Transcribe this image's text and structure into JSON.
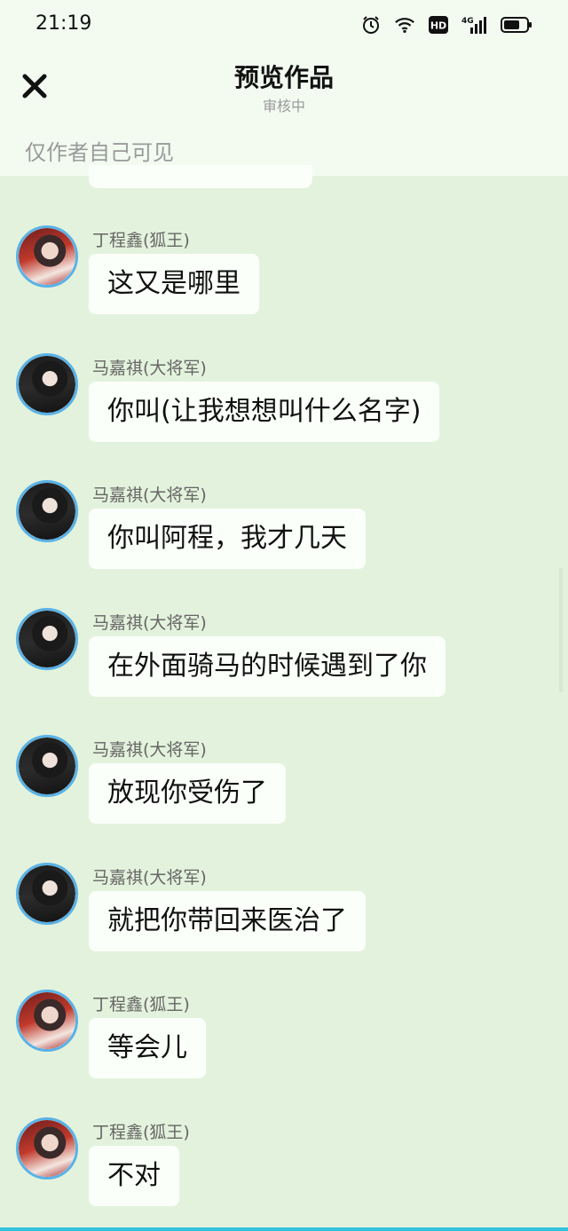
{
  "status_bar": {
    "time": "21:19",
    "icons": [
      "alarm-icon",
      "wifi-icon",
      "hd-icon",
      "signal-4g-icon",
      "battery-icon"
    ],
    "hd_label": "HD",
    "network_label": "4G"
  },
  "header": {
    "title": "预览作品",
    "subtitle": "审核中",
    "notice": "仅作者自己可见",
    "close_icon": "close-icon"
  },
  "colors": {
    "chat_bg": "#e3f2dc",
    "header_bg": "#f3fbf1",
    "bubble_bg": "#fbfffa",
    "avatar_ring": "#59b2e6",
    "bottom_accent": "#33c3e0"
  },
  "messages": [
    {
      "name": "丁程鑫(狐王)",
      "text": "这又是哪里",
      "avatar": "ding"
    },
    {
      "name": "马嘉祺(大将军)",
      "text": "你叫(让我想想叫什么名字)",
      "avatar": "ma"
    },
    {
      "name": "马嘉祺(大将军)",
      "text": "你叫阿程，我才几天",
      "avatar": "ma"
    },
    {
      "name": "马嘉祺(大将军)",
      "text": "在外面骑马的时候遇到了你",
      "avatar": "ma"
    },
    {
      "name": "马嘉祺(大将军)",
      "text": "放现你受伤了",
      "avatar": "ma"
    },
    {
      "name": "马嘉祺(大将军)",
      "text": "就把你带回来医治了",
      "avatar": "ma"
    },
    {
      "name": "丁程鑫(狐王)",
      "text": "等会儿",
      "avatar": "ding"
    },
    {
      "name": "丁程鑫(狐王)",
      "text": "不对",
      "avatar": "ding"
    }
  ]
}
